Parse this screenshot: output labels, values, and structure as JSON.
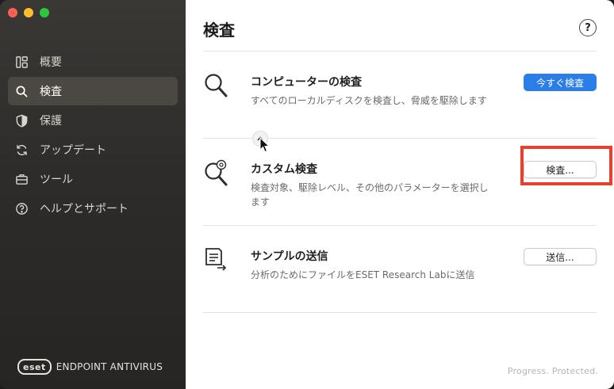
{
  "sidebar": {
    "items": [
      {
        "label": "概要",
        "icon": "overview-icon"
      },
      {
        "label": "検査",
        "icon": "search-icon",
        "active": true
      },
      {
        "label": "保護",
        "icon": "shield-icon"
      },
      {
        "label": "アップデート",
        "icon": "refresh-icon"
      },
      {
        "label": "ツール",
        "icon": "toolbox-icon"
      },
      {
        "label": "ヘルプとサポート",
        "icon": "help-icon"
      }
    ],
    "brand_logo": "eset",
    "brand_text": "ENDPOINT ANTIVIRUS"
  },
  "main": {
    "title": "検査",
    "help_label": "?",
    "rows": [
      {
        "title": "コンピューターの検査",
        "desc": "すべてのローカルディスクを検査し、脅威を駆除します",
        "button": "今すぐ検査",
        "icon": "magnifier-icon"
      },
      {
        "title": "カスタム検査",
        "desc": "検査対象、駆除レベル、その他のパラメーターを選択します",
        "button": "検査...",
        "icon": "magnifier-gear-icon"
      },
      {
        "title": "サンプルの送信",
        "desc": "分析のためにファイルをESET Research Labに送信",
        "button": "送信...",
        "icon": "document-send-icon"
      }
    ],
    "footer": "Progress. Protected."
  },
  "colors": {
    "primary_button": "#2b7de8",
    "highlight": "#e8402f",
    "sidebar_active": "#4b4844"
  }
}
